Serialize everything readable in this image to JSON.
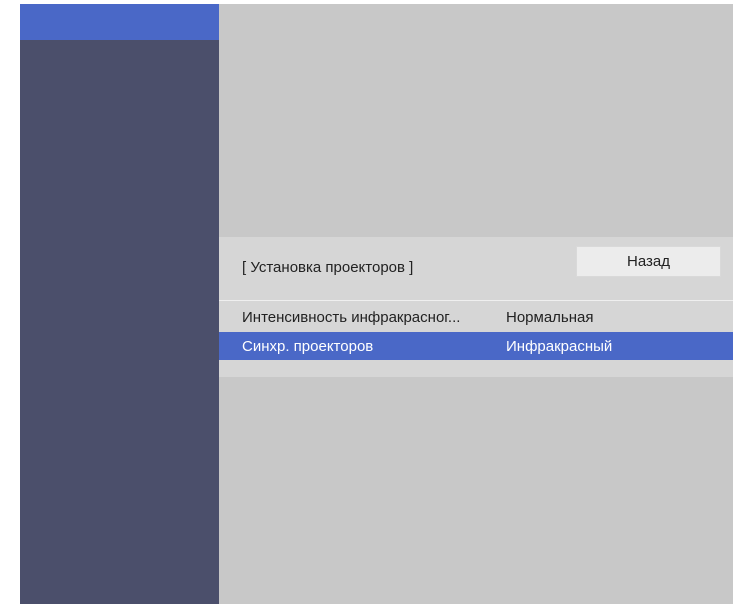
{
  "panel": {
    "title": "[ Установка проекторов ]",
    "back_label": "Назад"
  },
  "menu": {
    "items": [
      {
        "label": "Интенсивность инфракрасног...",
        "value": "Нормальная",
        "selected": false
      },
      {
        "label": "Синхр. проекторов",
        "value": "Инфракрасный",
        "selected": true
      }
    ]
  },
  "colors": {
    "screen_background": "#c8c8c8",
    "sidebar": "#4b4f6b",
    "accent": "#4a68c7",
    "panel": "#d6d6d6",
    "button": "#ececec"
  }
}
